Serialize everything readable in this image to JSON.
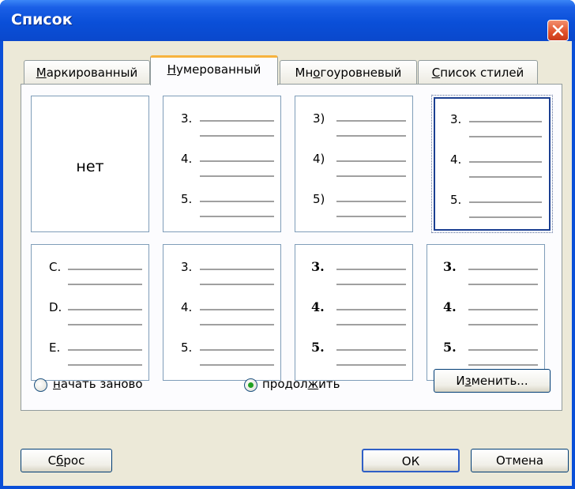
{
  "window": {
    "title": "Список"
  },
  "tabs": [
    {
      "pre": "",
      "acc": "М",
      "post": "аркированный"
    },
    {
      "pre": "",
      "acc": "Н",
      "post": "умерованный"
    },
    {
      "pre": "Мн",
      "acc": "о",
      "post": "гоуровневый"
    },
    {
      "pre": "",
      "acc": "С",
      "post": "писок стилей"
    }
  ],
  "grid": {
    "none_label": "нет",
    "cells": [
      {
        "labels": [
          "3.",
          "4.",
          "5."
        ]
      },
      {
        "labels": [
          "3)",
          "4)",
          "5)"
        ]
      },
      {
        "labels": [
          "3.",
          "4.",
          "5."
        ]
      },
      {
        "labels": [
          "C.",
          "D.",
          "E."
        ]
      },
      {
        "labels": [
          "3.",
          "4.",
          "5."
        ]
      },
      {
        "labels": [
          "3.",
          "4.",
          "5."
        ]
      },
      {
        "labels": [
          "3.",
          "4.",
          "5."
        ]
      }
    ]
  },
  "options": {
    "restart": {
      "pre": "",
      "acc": "н",
      "post": "ачать заново"
    },
    "continue": {
      "pre": "продол",
      "acc": "ж",
      "post": "ить"
    },
    "selected": "continue"
  },
  "buttons": {
    "modify": {
      "pre": "И",
      "acc": "з",
      "post": "менить..."
    },
    "reset": {
      "pre": "С",
      "acc": "б",
      "post": "рос"
    },
    "ok": "ОК",
    "cancel": "Отмена"
  },
  "colors": {
    "titlebar": "#0a4fd8",
    "dialog": "#ece9d8",
    "active_tab_accent": "#f7b33d",
    "selection": "#1b3f91"
  }
}
